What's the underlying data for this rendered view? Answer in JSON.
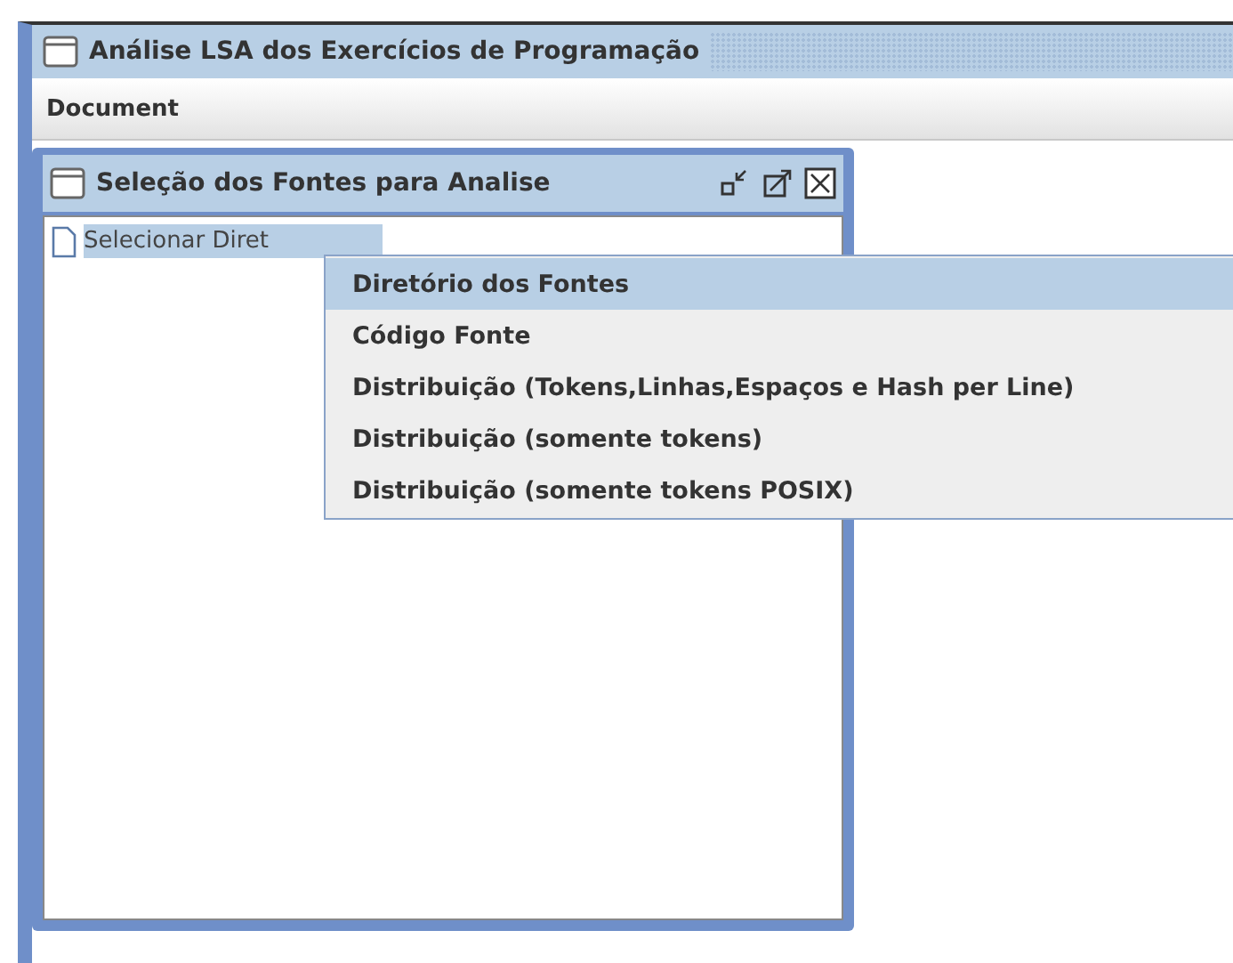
{
  "window": {
    "title": "Análise LSA dos Exercícios de Programação"
  },
  "menu_bar": [
    "Document"
  ],
  "internal_frame": {
    "title": "Seleção dos Fontes para Analise",
    "tree": [
      {
        "label": "Selecionar Diret",
        "selected": true
      }
    ]
  },
  "context_menu": [
    {
      "label": "Diretório dos Fontes",
      "selected": true
    },
    {
      "label": "Código Fonte",
      "selected": false
    },
    {
      "label": "Distribuição (Tokens,Linhas,Espaços e Hash per Line)",
      "selected": false
    },
    {
      "label": "Distribuição (somente tokens)",
      "selected": false
    },
    {
      "label": "Distribuição (somente tokens POSIX)",
      "selected": false
    }
  ]
}
